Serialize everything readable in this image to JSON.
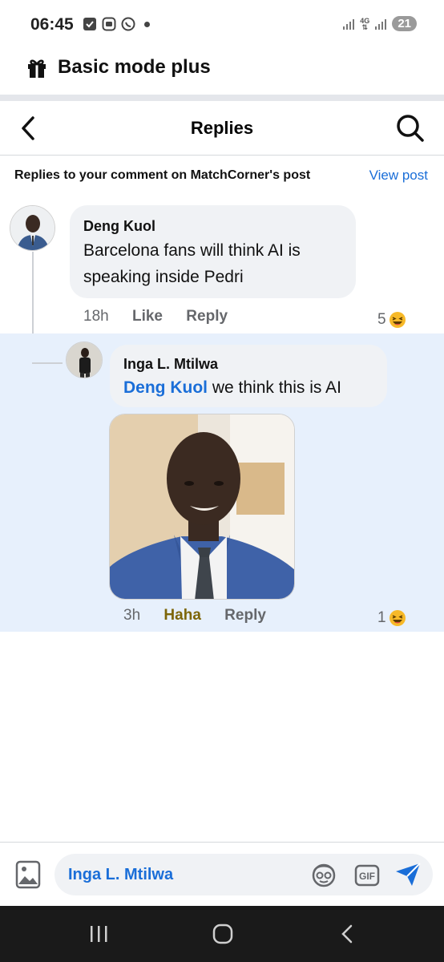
{
  "status_bar": {
    "time": "06:45",
    "network": "4G",
    "battery": "21"
  },
  "mode_bar": {
    "title": "Basic mode plus",
    "icon": "gift-icon"
  },
  "header": {
    "title": "Replies",
    "back_icon": "back-arrow-icon",
    "search_icon": "search-icon"
  },
  "context": {
    "text": "Replies to your comment on MatchCorner's post",
    "view_post_label": "View post"
  },
  "comments": [
    {
      "author": "Deng Kuol",
      "text": "Barcelona fans will think AI is speaking inside Pedri",
      "time": "18h",
      "like_label": "Like",
      "reply_label": "Reply",
      "reaction_count": "5",
      "reaction_icon": "laughing-emoji-icon"
    },
    {
      "author": "Inga L. Mtilwa",
      "mention": "Deng Kuol",
      "text": " we think this is AI",
      "time": "3h",
      "reaction_label": "Haha",
      "reply_label": "Reply",
      "reaction_count": "1",
      "reaction_icon": "laughing-emoji-icon"
    }
  ],
  "composer": {
    "value": "Inga L. Mtilwa",
    "icons": [
      "gallery-icon",
      "sticker-icon",
      "gif-icon",
      "send-icon"
    ]
  },
  "colors": {
    "accent": "#1a6ed8",
    "haha": "#7d6608",
    "reply_highlight": "#e7f0fc"
  }
}
